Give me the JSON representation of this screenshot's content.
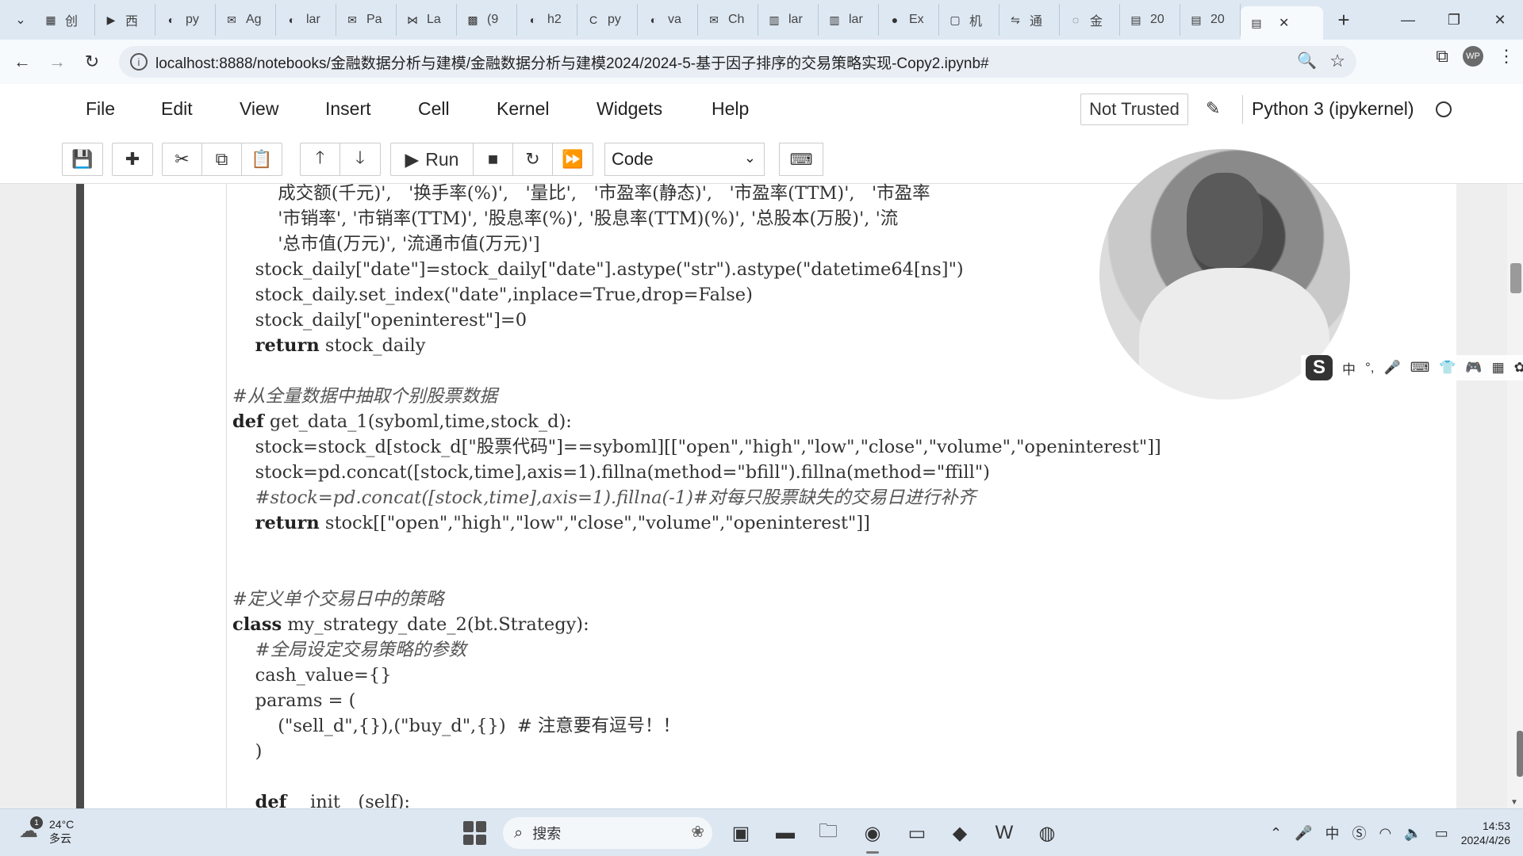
{
  "browser": {
    "tabs": [
      {
        "icon": "calendar",
        "label": "创"
      },
      {
        "icon": "play",
        "label": "西"
      },
      {
        "icon": "github",
        "label": "py"
      },
      {
        "icon": "mail",
        "label": "Ag"
      },
      {
        "icon": "github",
        "label": "lar"
      },
      {
        "icon": "mail",
        "label": "Pa"
      },
      {
        "icon": "latex",
        "label": "La"
      },
      {
        "icon": "code",
        "label": "(9"
      },
      {
        "icon": "github",
        "label": "h2"
      },
      {
        "icon": "c-box",
        "label": "py"
      },
      {
        "icon": "github",
        "label": "va"
      },
      {
        "icon": "mail",
        "label": "Ch"
      },
      {
        "icon": "book",
        "label": "lar"
      },
      {
        "icon": "book",
        "label": "lar"
      },
      {
        "icon": "user",
        "label": "Ex"
      },
      {
        "icon": "box",
        "label": "机"
      },
      {
        "icon": "translate",
        "label": "通"
      },
      {
        "icon": "spinner",
        "label": "金"
      },
      {
        "icon": "notebook",
        "label": "20"
      },
      {
        "icon": "notebook",
        "label": "20"
      }
    ],
    "active_tab_close": "✕",
    "new_tab": "+",
    "url": "localhost:8888/notebooks/金融数据分析与建模/金融数据分析与建模2024/2024-5-基于因子排序的交易策略实现-Copy2.ipynb#",
    "profile_initials": "WP"
  },
  "jupyter": {
    "menu": [
      "File",
      "Edit",
      "View",
      "Insert",
      "Cell",
      "Kernel",
      "Widgets",
      "Help"
    ],
    "trust_status": "Not Trusted",
    "kernel": "Python 3 (ipykernel)",
    "toolbar": {
      "run_label": "Run",
      "cell_type": "Code"
    }
  },
  "code_lines": [
    {
      "text": "        成交额(千元)',   '换手率(%)',   '量比',   '市盈率(静态)',   '市盈率(TTM)',   '市盈率",
      "cls": ""
    },
    {
      "text": "        '市销率', '市销率(TTM)', '股息率(%)', '股息率(TTM)(%)', '总股本(万股)', '流",
      "cls": ""
    },
    {
      "text": "        '总市值(万元)', '流通市值(万元)']",
      "cls": ""
    },
    {
      "text": "    stock_daily[\"date\"]=stock_daily[\"date\"].astype(\"str\").astype(\"datetime64[ns]\")",
      "cls": ""
    },
    {
      "text": "    stock_daily.set_index(\"date\",inplace=True,drop=False)",
      "cls": ""
    },
    {
      "text": "    stock_daily[\"openinterest\"]=0",
      "cls": ""
    },
    {
      "text": "    return stock_daily",
      "cls": "kwline"
    },
    {
      "text": "",
      "cls": ""
    },
    {
      "text": "#从全量数据中抽取个别股票数据",
      "cls": "cmt"
    },
    {
      "text": "def get_data_1(syboml,time,stock_d):",
      "cls": "kwline"
    },
    {
      "text": "    stock=stock_d[stock_d[\"股票代码\"]==syboml][[\"open\",\"high\",\"low\",\"close\",\"volume\",\"openinterest\"]]",
      "cls": ""
    },
    {
      "text": "    stock=pd.concat([stock,time],axis=1).fillna(method=\"bfill\").fillna(method=\"ffill\")",
      "cls": ""
    },
    {
      "text": "    #stock=pd.concat([stock,time],axis=1).fillna(-1)#对每只股票缺失的交易日进行补齐",
      "cls": "cmt"
    },
    {
      "text": "    return stock[[\"open\",\"high\",\"low\",\"close\",\"volume\",\"openinterest\"]]",
      "cls": "kwline"
    },
    {
      "text": "",
      "cls": ""
    },
    {
      "text": "",
      "cls": ""
    },
    {
      "text": "#定义单个交易日中的策略",
      "cls": "cmt"
    },
    {
      "text": "class my_strategy_date_2(bt.Strategy):",
      "cls": "kwline"
    },
    {
      "text": "    #全局设定交易策略的参数",
      "cls": "cmt"
    },
    {
      "text": "    cash_value={}",
      "cls": ""
    },
    {
      "text": "    params = (",
      "cls": ""
    },
    {
      "text": "        (\"sell_d\",{}),(\"buy_d\",{})  # 注意要有逗号！！",
      "cls": ""
    },
    {
      "text": "    )",
      "cls": ""
    },
    {
      "text": "",
      "cls": ""
    },
    {
      "text": "    def __init__(self):",
      "cls": "kwline"
    }
  ],
  "ime": {
    "items": [
      "中",
      "°,",
      "🎤",
      "⌨",
      "👕",
      "🎮",
      "▦",
      "✿"
    ]
  },
  "taskbar": {
    "weather_temp": "24°C",
    "weather_desc": "多云",
    "notification_count": "1",
    "search_placeholder": "搜索",
    "time": "14:53",
    "date": "2024/4/26"
  }
}
